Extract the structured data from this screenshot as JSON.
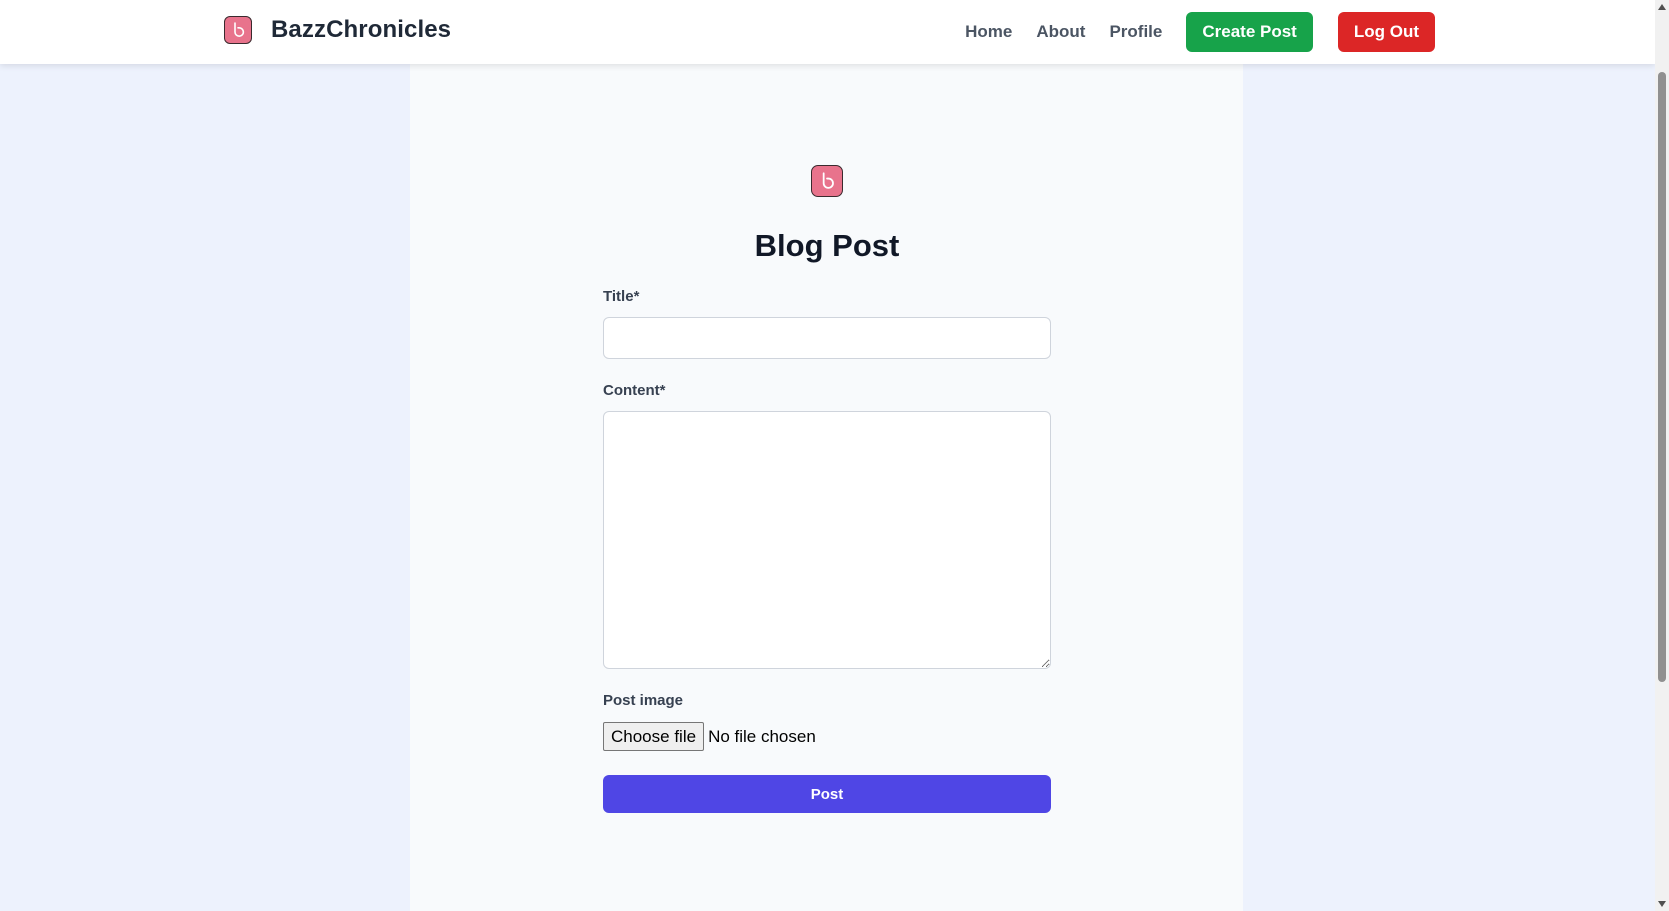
{
  "navbar": {
    "brand": "BazzChronicles",
    "logo_icon": "b-logo-icon",
    "links": [
      "Home",
      "About",
      "Profile"
    ],
    "create_label": "Create Post",
    "logout_label": "Log Out"
  },
  "form": {
    "heading": "Blog Post",
    "title_label": "Title*",
    "title_value": "",
    "content_label": "Content*",
    "content_value": "",
    "image_label": "Post image",
    "choose_file_label": "Choose file",
    "file_status": "No file chosen",
    "submit_label": "Post"
  },
  "colors": {
    "create_button": "#17a34a",
    "logout_button": "#dc2626",
    "submit_button": "#4f46e5",
    "logo": "#e8738c"
  }
}
